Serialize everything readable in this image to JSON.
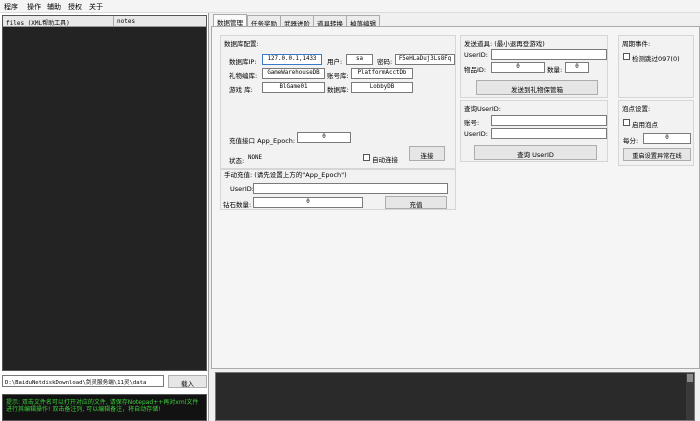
{
  "menu": [
    "程序",
    "操作",
    "辅助",
    "授权",
    "关于"
  ],
  "file_list": {
    "col_files": "files (XML帮助工具)",
    "col_notes": "notes"
  },
  "path_input": "D:\\BaiduNetdiskDownload\\剑灵服务端\\11灵\\data",
  "load_button": "载入",
  "tip_text": "提示: 双击文件名可以打开对应的文件, 请保存Notepad++再对xml文件进行其编辑操作! 双击备注列, 可以编辑备注，将自动存储!",
  "tabs": [
    "数据管理",
    "任务奖励",
    "武器进阶",
    "道具转换",
    "掉落编辑"
  ],
  "db_config": {
    "title": "数据库配置:",
    "ip_label": "数据库IP:",
    "ip_value": "127.0.0.1,1433",
    "user_label": "用户:",
    "user_value": "sa",
    "pwd_label": "密码:",
    "pwd_value": "F5eHLaDuj3Ls8Fq",
    "gift_db_label": "礼物编库:",
    "gift_db_value": "GameWarehouseDB",
    "acct_db_label": "账号库:",
    "acct_db_value": "PlatformAcctDb",
    "game_db_label": "游戏  库:",
    "game_db_value": "BlGame01",
    "data_db_label": "数据库:",
    "data_db_value": "LobbyDB",
    "recharge_label": "充值接口 App_Epoch:",
    "recharge_value": "0",
    "status_label": "状态:",
    "status_value": "NONE",
    "auto_connect": "自动连接",
    "connect_button": "连接"
  },
  "manual_recharge": {
    "title": "手动充值: (请先设置上方的\"App_Epoch\")",
    "userid_label": "UserID:",
    "userid_value": "",
    "amount_label": "钻石数量:",
    "amount_value": "0",
    "recharge_button": "充值"
  },
  "send_item": {
    "title": "发送道具: (最小退再登游戏)",
    "userid_label": "UserID:",
    "itemid_label": "物品ID:",
    "itemid_value": "0",
    "qty_label": "数量:",
    "qty_value": "0",
    "send_button": "发送到礼物保管箱"
  },
  "query_userid": {
    "title": "查询UserID:",
    "account_label": "账号:",
    "userid_label": "UserID:",
    "query_button": "查询 UserID"
  },
  "weekly_event": {
    "title": "周期事件:",
    "check_label": "检测跳过097(0)"
  },
  "bubble_settings": {
    "title": "泡点设置:",
    "enable_label": "启用泡点",
    "per_label": "每分:",
    "per_value": "0",
    "restart_button": "重启设置异常在线"
  }
}
